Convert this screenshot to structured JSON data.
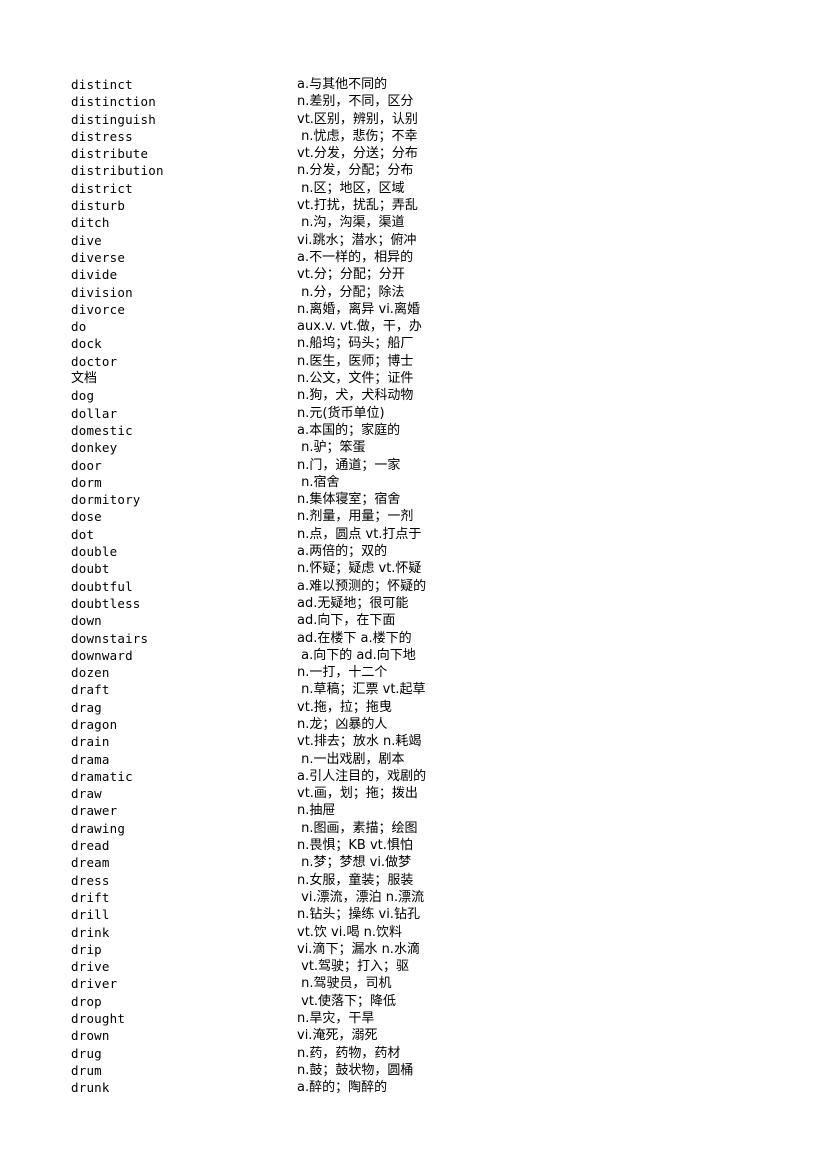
{
  "document": {
    "type": "vocabulary-list",
    "background_color": "#ffffff",
    "text_color": "#000000",
    "entries": [
      {
        "term": "distinct",
        "definition": "a.与其他不同的"
      },
      {
        "term": "distinction",
        "definition": "n.差别，不同，区分"
      },
      {
        "term": "distinguish",
        "definition": "vt.区别，辨别，认别"
      },
      {
        "term": "distress",
        "definition": " n.忧虑，悲伤；不幸"
      },
      {
        "term": "distribute",
        "definition": "vt.分发，分送；分布"
      },
      {
        "term": "distribution",
        "definition": "n.分发，分配；分布"
      },
      {
        "term": "district",
        "definition": " n.区；地区，区域"
      },
      {
        "term": "disturb",
        "definition": "vt.打扰，扰乱；弄乱"
      },
      {
        "term": "ditch",
        "definition": " n.沟，沟渠，渠道"
      },
      {
        "term": "dive",
        "definition": "vi.跳水；潜水；俯冲"
      },
      {
        "term": "diverse",
        "definition": "a.不一样的，相异的"
      },
      {
        "term": "divide",
        "definition": "vt.分；分配；分开"
      },
      {
        "term": "division",
        "definition": " n.分，分配；除法"
      },
      {
        "term": "divorce",
        "definition": "n.离婚，离异 vi.离婚"
      },
      {
        "term": "do",
        "definition": "aux.v. vt.做，干，办"
      },
      {
        "term": "dock",
        "definition": "n.船坞；码头；船厂"
      },
      {
        "term": "doctor",
        "definition": "n.医生，医师；博士"
      },
      {
        "term": "文档",
        "definition": "n.公文，文件；证件"
      },
      {
        "term": "dog",
        "definition": "n.狗，犬，犬科动物"
      },
      {
        "term": "dollar",
        "definition": "n.元(货币单位)"
      },
      {
        "term": "domestic",
        "definition": "a.本国的；家庭的"
      },
      {
        "term": "donkey",
        "definition": " n.驴；笨蛋"
      },
      {
        "term": "door",
        "definition": "n.门，通道；一家"
      },
      {
        "term": "dorm",
        "definition": " n.宿舍"
      },
      {
        "term": "dormitory",
        "definition": "n.集体寝室；宿舍"
      },
      {
        "term": "dose",
        "definition": "n.剂量，用量；一剂"
      },
      {
        "term": "dot",
        "definition": "n.点，圆点 vt.打点于"
      },
      {
        "term": "double",
        "definition": "a.两倍的；双的"
      },
      {
        "term": "doubt",
        "definition": "n.怀疑；疑虑 vt.怀疑"
      },
      {
        "term": "doubtful",
        "definition": "a.难以预测的；怀疑的"
      },
      {
        "term": "doubtless",
        "definition": "ad.无疑地；很可能"
      },
      {
        "term": "down",
        "definition": "ad.向下，在下面"
      },
      {
        "term": "downstairs",
        "definition": "ad.在楼下 a.楼下的"
      },
      {
        "term": "downward",
        "definition": " a.向下的 ad.向下地"
      },
      {
        "term": "dozen",
        "definition": "n.一打，十二个"
      },
      {
        "term": "draft",
        "definition": " n.草稿；汇票 vt.起草"
      },
      {
        "term": "drag",
        "definition": "vt.拖，拉；拖曳"
      },
      {
        "term": "dragon",
        "definition": "n.龙；凶暴的人"
      },
      {
        "term": "drain",
        "definition": "vt.排去；放水 n.耗竭"
      },
      {
        "term": "drama",
        "definition": " n.一出戏剧，剧本"
      },
      {
        "term": "dramatic",
        "definition": "a.引人注目的，戏剧的"
      },
      {
        "term": "draw",
        "definition": "vt.画，划；拖；拨出"
      },
      {
        "term": "drawer",
        "definition": "n.抽屉"
      },
      {
        "term": "drawing",
        "definition": " n.图画，素描；绘图"
      },
      {
        "term": "dread",
        "definition": "n.畏惧；KB vt.惧怕"
      },
      {
        "term": "dream",
        "definition": " n.梦；梦想 vi.做梦"
      },
      {
        "term": "dress",
        "definition": "n.女服，童装；服装"
      },
      {
        "term": "drift",
        "definition": " vi.漂流，漂泊 n.漂流"
      },
      {
        "term": "drill",
        "definition": "n.钻头；操练 vi.钻孔"
      },
      {
        "term": "drink",
        "definition": "vt.饮 vi.喝 n.饮料"
      },
      {
        "term": "drip",
        "definition": "vi.滴下；漏水 n.水滴"
      },
      {
        "term": "drive",
        "definition": " vt.驾驶；打入；驱"
      },
      {
        "term": "driver",
        "definition": " n.驾驶员，司机"
      },
      {
        "term": "drop",
        "definition": " vt.使落下；降低"
      },
      {
        "term": "drought",
        "definition": "n.旱灾，干旱"
      },
      {
        "term": "drown",
        "definition": "vi.淹死，溺死"
      },
      {
        "term": "drug",
        "definition": "n.药，药物，药材"
      },
      {
        "term": "drum",
        "definition": "n.鼓；鼓状物，圆桶"
      },
      {
        "term": "drunk",
        "definition": "a.醉的；陶醉的"
      }
    ]
  }
}
